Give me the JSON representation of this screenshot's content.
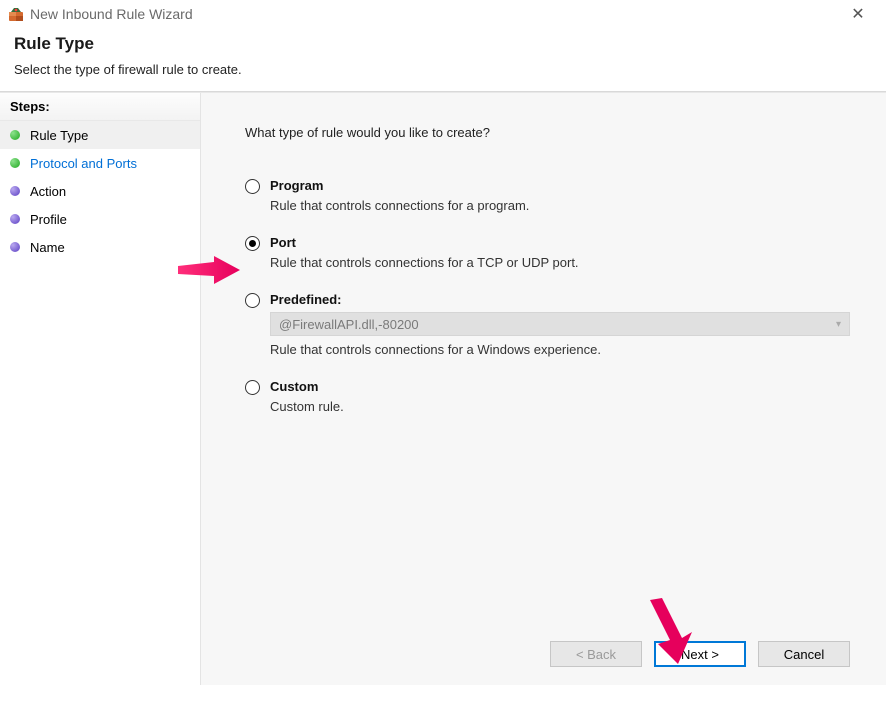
{
  "window": {
    "title": "New Inbound Rule Wizard"
  },
  "header": {
    "heading": "Rule Type",
    "subtitle": "Select the type of firewall rule to create."
  },
  "sidebar": {
    "steps_label": "Steps:",
    "items": [
      {
        "label": "Rule Type",
        "bullet": "green",
        "active": true
      },
      {
        "label": "Protocol and Ports",
        "bullet": "green",
        "link": true
      },
      {
        "label": "Action",
        "bullet": "purple"
      },
      {
        "label": "Profile",
        "bullet": "purple"
      },
      {
        "label": "Name",
        "bullet": "purple"
      }
    ]
  },
  "content": {
    "prompt": "What type of rule would you like to create?",
    "options": [
      {
        "id": "program",
        "label": "Program",
        "desc": "Rule that controls connections for a program.",
        "selected": false
      },
      {
        "id": "port",
        "label": "Port",
        "desc": "Rule that controls connections for a TCP or UDP port.",
        "selected": true
      },
      {
        "id": "predefined",
        "label": "Predefined:",
        "desc": "Rule that controls connections for a Windows experience.",
        "selected": false,
        "dropdown_value": "@FirewallAPI.dll,-80200"
      },
      {
        "id": "custom",
        "label": "Custom",
        "desc": "Custom rule.",
        "selected": false
      }
    ]
  },
  "buttons": {
    "back": "< Back",
    "next": "Next >",
    "cancel": "Cancel"
  }
}
